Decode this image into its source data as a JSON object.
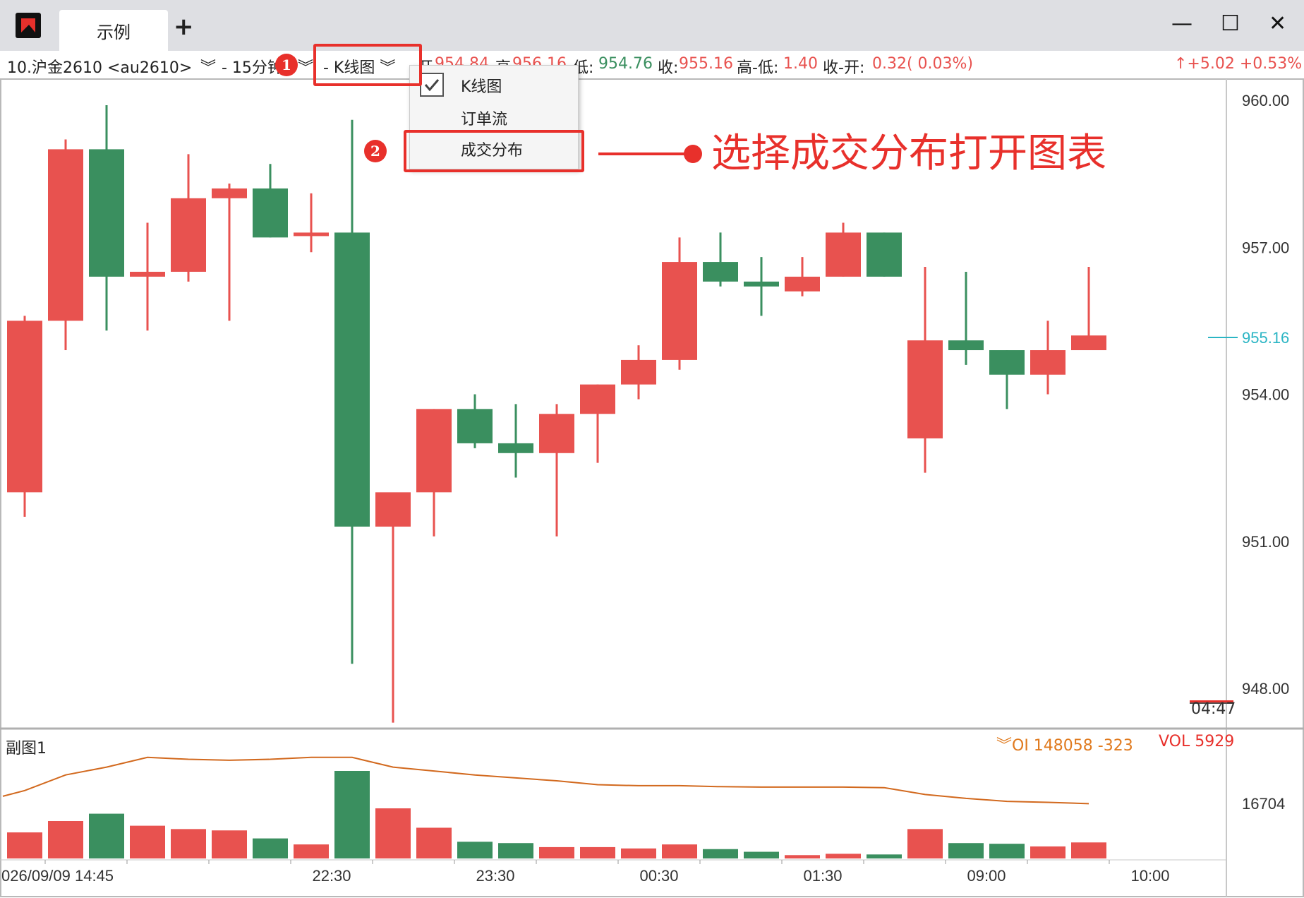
{
  "window": {
    "tab_title": "示例",
    "add_tab": "+",
    "minimize": "—",
    "maximize": "☐",
    "close": "✕"
  },
  "toolbar": {
    "instrument": "10.沪金2610 <au2610>",
    "chevron": "︾",
    "period": "- 15分钟",
    "chart_type": "- K线图 ︾",
    "open_label": "开",
    "open_value": "954.84",
    "high_label": "高",
    "high_value": "956.16",
    "low_label": "低:",
    "low_value": "954.76",
    "close_label": "收:",
    "close_value": "955.16",
    "hl_label": "高-低:",
    "hl_value": "1.40",
    "co_label": "收-开:",
    "co_value": "0.32( 0.03%)",
    "change": "↑+5.02 +0.53%"
  },
  "menu": {
    "items": [
      "K线图",
      "订单流",
      "成交分布"
    ],
    "checked": "K线图"
  },
  "annotations": {
    "badge1": "1",
    "badge2": "2",
    "text": "选择成交分布打开图表"
  },
  "subchart": {
    "title": "副图1",
    "oi_label": "︾OI 148058 -323",
    "vol_label": "VOL 5929",
    "axis_value": "16704"
  },
  "time_box": "04:47",
  "colors": {
    "up": "#e8524f",
    "down": "#3a8f5f",
    "oi_line": "#d2691e",
    "accent": "#e8302b",
    "last_price": "#2bb5c4"
  },
  "chart_data": {
    "type": "candlestick",
    "period": "15分钟",
    "ylim": [
      947.0,
      960.5
    ],
    "yticks": [
      960.0,
      957.0,
      954.0,
      951.0,
      948.0
    ],
    "ytick_labels": [
      "960.00",
      "957.00",
      "954.00",
      "951.00",
      "948.00"
    ],
    "last_price": 955.16,
    "last_price_label": "955.16",
    "xtick_labels": [
      "026/09/09 14:45",
      "22:30",
      "23:30",
      "00:30",
      "01:30",
      "09:00",
      "10:00"
    ],
    "xtick_bar_index": [
      2,
      7,
      11,
      15,
      19,
      23,
      27
    ],
    "candles": [
      {
        "o": 952.0,
        "h": 955.6,
        "l": 951.5,
        "c": 955.5
      },
      {
        "o": 955.5,
        "h": 959.2,
        "l": 954.9,
        "c": 959.0
      },
      {
        "o": 959.0,
        "h": 959.9,
        "l": 955.3,
        "c": 956.4
      },
      {
        "o": 956.4,
        "h": 957.5,
        "l": 955.3,
        "c": 956.5
      },
      {
        "o": 956.5,
        "h": 958.9,
        "l": 956.3,
        "c": 958.0
      },
      {
        "o": 958.0,
        "h": 958.3,
        "l": 955.5,
        "c": 958.2
      },
      {
        "o": 958.2,
        "h": 958.7,
        "l": 957.2,
        "c": 957.2
      },
      {
        "o": 957.3,
        "h": 958.1,
        "l": 956.9,
        "c": 957.3
      },
      {
        "o": 957.3,
        "h": 959.6,
        "l": 948.5,
        "c": 951.3
      },
      {
        "o": 951.3,
        "h": 951.9,
        "l": 947.3,
        "c": 952.0
      },
      {
        "o": 952.0,
        "h": 953.7,
        "l": 951.1,
        "c": 953.7
      },
      {
        "o": 953.7,
        "h": 954.0,
        "l": 952.9,
        "c": 953.0
      },
      {
        "o": 953.0,
        "h": 953.8,
        "l": 952.3,
        "c": 952.8
      },
      {
        "o": 952.8,
        "h": 953.8,
        "l": 951.1,
        "c": 953.6
      },
      {
        "o": 953.6,
        "h": 954.2,
        "l": 952.6,
        "c": 954.2
      },
      {
        "o": 954.2,
        "h": 955.0,
        "l": 953.9,
        "c": 954.7
      },
      {
        "o": 954.7,
        "h": 957.2,
        "l": 954.5,
        "c": 956.7
      },
      {
        "o": 956.7,
        "h": 957.3,
        "l": 956.2,
        "c": 956.3
      },
      {
        "o": 956.3,
        "h": 956.8,
        "l": 955.6,
        "c": 956.2
      },
      {
        "o": 956.1,
        "h": 956.8,
        "l": 956.0,
        "c": 956.4
      },
      {
        "o": 956.4,
        "h": 957.5,
        "l": 956.4,
        "c": 957.3
      },
      {
        "o": 957.3,
        "h": 957.3,
        "l": 956.4,
        "c": 956.4
      },
      {
        "o": 953.1,
        "h": 956.6,
        "l": 952.4,
        "c": 955.1
      },
      {
        "o": 955.1,
        "h": 956.5,
        "l": 954.6,
        "c": 954.9
      },
      {
        "o": 954.9,
        "h": 954.9,
        "l": 953.7,
        "c": 954.4
      },
      {
        "o": 954.4,
        "h": 955.5,
        "l": 954.0,
        "c": 954.9
      },
      {
        "o": 954.9,
        "h": 956.6,
        "l": 954.9,
        "c": 955.2
      }
    ],
    "volume": [
      3900,
      5600,
      6700,
      4900,
      4400,
      4200,
      3000,
      2100,
      13100,
      7500,
      4600,
      2500,
      2300,
      1700,
      1700,
      1500,
      2100,
      1400,
      1000,
      500,
      700,
      600,
      4400,
      2300,
      2200,
      1800,
      2400
    ],
    "open_interest": [
      148440,
      148520,
      148560,
      148610,
      148600,
      148595,
      148600,
      148610,
      148610,
      148560,
      148540,
      148520,
      148505,
      148490,
      148470,
      148465,
      148465,
      148460,
      148458,
      148458,
      148458,
      148455,
      148420,
      148400,
      148385,
      148380,
      148373
    ]
  }
}
